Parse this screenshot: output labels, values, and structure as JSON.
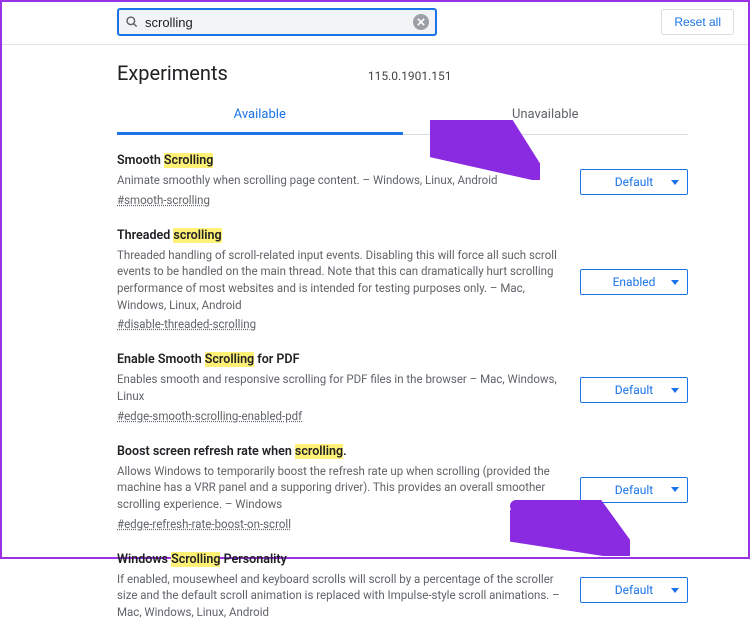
{
  "search": {
    "placeholder": "",
    "value": "scrolling"
  },
  "reset_label": "Reset all",
  "page_title": "Experiments",
  "version": "115.0.1901.151",
  "tabs": {
    "available": "Available",
    "unavailable": "Unavailable"
  },
  "highlight": "scrolling",
  "flags": [
    {
      "title_pre": "Smooth ",
      "title_hl": "Scrolling",
      "title_post": "",
      "desc": "Animate smoothly when scrolling page content. – Windows, Linux, Android",
      "hash": "#smooth-scrolling",
      "value": "Default"
    },
    {
      "title_pre": "Threaded ",
      "title_hl": "scrolling",
      "title_post": "",
      "desc": "Threaded handling of scroll-related input events. Disabling this will force all such scroll events to be handled on the main thread. Note that this can dramatically hurt scrolling performance of most websites and is intended for testing purposes only. – Mac, Windows, Linux, Android",
      "hash": "#disable-threaded-scrolling",
      "value": "Enabled"
    },
    {
      "title_pre": "Enable Smooth ",
      "title_hl": "Scrolling",
      "title_post": " for PDF",
      "desc": "Enables smooth and responsive scrolling for PDF files in the browser – Mac, Windows, Linux",
      "hash": "#edge-smooth-scrolling-enabled-pdf",
      "value": "Default"
    },
    {
      "title_pre": "Boost screen refresh rate when ",
      "title_hl": "scrolling",
      "title_post": ".",
      "desc": "Allows Windows to temporarily boost the refresh rate up when scrolling (provided the machine has a VRR panel and a supporing driver). This provides an overall smoother scrolling experience. – Windows",
      "hash": "#edge-refresh-rate-boost-on-scroll",
      "value": "Default"
    },
    {
      "title_pre": "Windows ",
      "title_hl": "Scrolling",
      "title_post": " Personality",
      "desc": "If enabled, mousewheel and keyboard scrolls will scroll by a percentage of the scroller size and the default scroll animation is replaced with Impulse-style scroll animations. – Mac, Windows, Linux, Android",
      "hash": "",
      "value": "Default"
    }
  ]
}
